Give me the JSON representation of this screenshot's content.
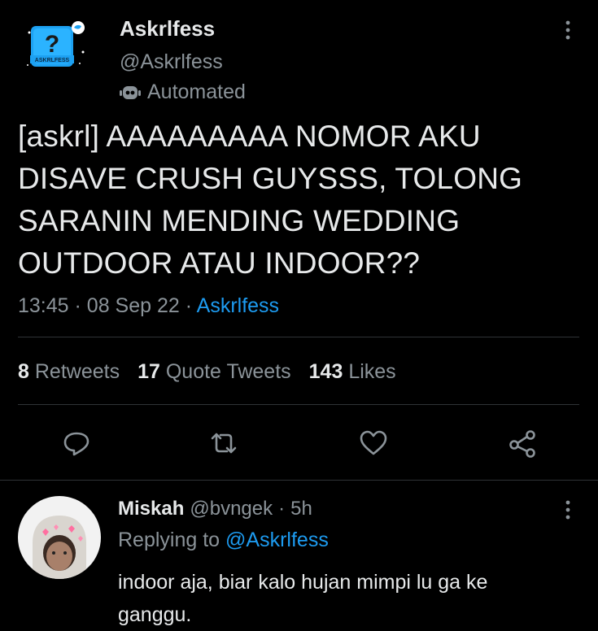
{
  "tweet": {
    "author_name": "Askrlfess",
    "author_handle": "@Askrlfess",
    "automated_label": "Automated",
    "avatar_text": "ASKRLFESS",
    "text": "[askrl] AAAAAAAAA NOMOR AKU DISAVE CRUSH GUYSSS, TOLONG SARANIN MENDING WEDDING OUTDOOR ATAU INDOOR??",
    "time": "13:45",
    "date": "08 Sep 22",
    "source": "Askrlfess",
    "sep": "·"
  },
  "stats": {
    "retweets_count": "8",
    "retweets_label": "Retweets",
    "quotes_count": "17",
    "quotes_label": "Quote Tweets",
    "likes_count": "143",
    "likes_label": "Likes"
  },
  "actions": [
    "reply-icon",
    "retweet-icon",
    "like-icon",
    "share-icon"
  ],
  "reply": {
    "name": "Miskah",
    "handle": "@bvngek",
    "sep": "·",
    "age": "5h",
    "replying_prefix": "Replying to",
    "replying_to": "@Askrlfess",
    "text": "indoor aja, biar kalo hujan mimpi lu ga ke ganggu."
  },
  "colors": {
    "background": "#000000",
    "text": "#e7e9ea",
    "muted": "#8b9399",
    "accent": "#1d9bf0",
    "divider": "#2f3336"
  }
}
